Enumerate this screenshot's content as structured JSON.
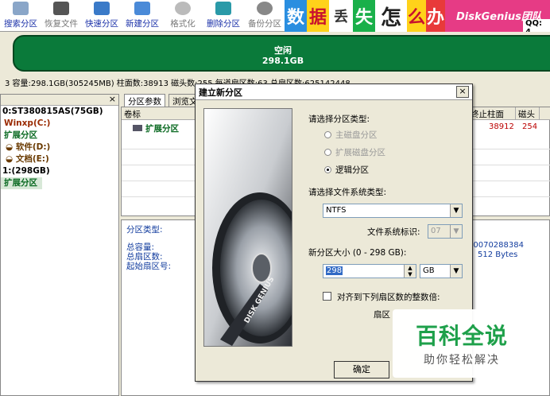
{
  "toolbar": {
    "buttons": [
      {
        "label": "搜索分区",
        "icon": "search-partition-icon"
      },
      {
        "label": "恢复文件",
        "icon": "restore-file-icon"
      },
      {
        "label": "快速分区",
        "icon": "quick-partition-icon"
      },
      {
        "label": "新建分区",
        "icon": "new-partition-icon"
      },
      {
        "label": "格式化",
        "icon": "format-icon"
      },
      {
        "label": "删除分区",
        "icon": "delete-partition-icon"
      },
      {
        "label": "备份分区",
        "icon": "backup-partition-icon"
      }
    ]
  },
  "banner": {
    "tiles": [
      "数",
      "据",
      "丢",
      "失",
      "怎",
      "么",
      "办"
    ],
    "brand": "DiskGenius团队",
    "qq": "QQ: 4"
  },
  "disk_bar": {
    "label": "空闲",
    "size": "298.1GB"
  },
  "info_bar": {
    "text": "3 容量:298.1GB(305245MB)  柱面数:38913  磁头数:255  每道扇区数:63  总扇区数:625142448"
  },
  "tree": {
    "items": [
      {
        "text": "0:ST380815AS(75GB)",
        "color": "#000000"
      },
      {
        "text": "Winxp(C:)",
        "color": "#9a2a00"
      },
      {
        "text": "扩展分区",
        "color": "#0a6a22"
      },
      {
        "text": "软件(D:)",
        "color": "#6a3a00"
      },
      {
        "text": "文档(E:)",
        "color": "#6a3a00"
      },
      {
        "text": "1:(298GB)",
        "color": "#000000"
      },
      {
        "text": "扩展分区",
        "color": "#0a6a22"
      }
    ]
  },
  "right_panel": {
    "tabs": [
      "分区参数",
      "浏览文"
    ],
    "headers": {
      "volume": "卷标",
      "end_cyl": "终止柱面",
      "head": "磁头"
    },
    "row": {
      "name": "扩展分区",
      "end_cyl": "38912",
      "head": "254"
    },
    "details": {
      "type_label": "分区类型:",
      "capacity_label": "总容量:",
      "sectors_label": "总扇区数:",
      "start_label": "起始扇区号:",
      "value1": "20070288384",
      "value2": "512 Bytes"
    }
  },
  "dialog": {
    "title": "建立新分区",
    "close": "×",
    "image_text": "DISK GENIUS",
    "type_prompt": "请选择分区类型:",
    "radio_primary": "主磁盘分区",
    "radio_extended": "扩展磁盘分区",
    "radio_logical": "逻辑分区",
    "fs_prompt": "请选择文件系统类型:",
    "fs_value": "NTFS",
    "fs_id_label": "文件系统标识:",
    "fs_id_value": "07",
    "size_label": "新分区大小 (0 - 298 GB):",
    "size_value": "298",
    "unit_value": "GB",
    "align_label": "对齐到下列扇区数的整数倍:",
    "sector_label": "扇区",
    "ok_button": "确定"
  },
  "watermark": {
    "title": "百科全说",
    "subtitle": "助你轻松解决"
  }
}
